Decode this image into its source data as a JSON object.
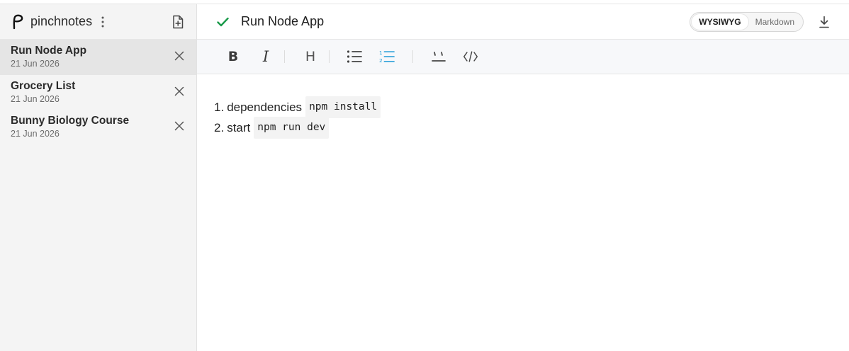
{
  "app": {
    "name": "pinchnotes"
  },
  "sidebar": {
    "notes": [
      {
        "title": "Run Node App",
        "date": "21 Jun 2026",
        "active": true
      },
      {
        "title": "Grocery List",
        "date": "21 Jun 2026",
        "active": false
      },
      {
        "title": "Bunny Biology Course",
        "date": "21 Jun 2026",
        "active": false
      }
    ]
  },
  "header": {
    "title": "Run Node App",
    "modes": {
      "wysiwyg": "WYSIWYG",
      "markdown": "Markdown",
      "active": "WYSIWYG"
    }
  },
  "toolbar": {
    "icons": [
      "bold-icon",
      "italic-icon",
      "heading-icon",
      "bullet-list-icon",
      "ordered-list-icon",
      "inline-code-icon",
      "code-block-icon"
    ],
    "active": "ordered-list-icon",
    "accent": "#1e9bd7"
  },
  "content": {
    "items": [
      {
        "num": "1.",
        "text": "dependencies",
        "code": "npm install"
      },
      {
        "num": "2.",
        "text": "start",
        "code": "npm run dev"
      }
    ]
  },
  "colors": {
    "check": "#1a9a4a",
    "accent": "#1e9bd7"
  }
}
